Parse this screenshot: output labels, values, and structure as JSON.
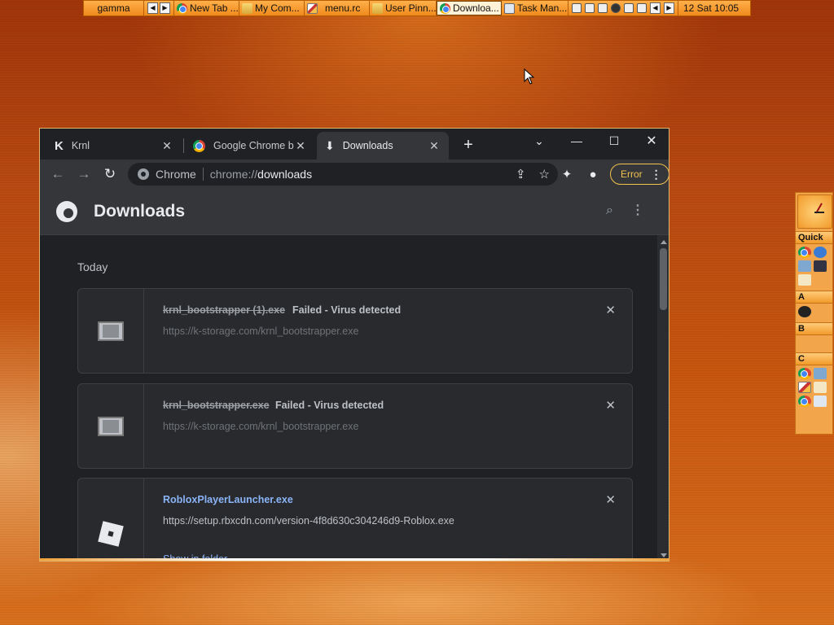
{
  "taskbar": {
    "workspace": "gamma",
    "tasks": [
      {
        "label": "New Tab ...",
        "icon": "chrome-icon"
      },
      {
        "label": "My Com...",
        "icon": "folder-icon"
      },
      {
        "label": "menu.rc",
        "icon": "editor-icon"
      },
      {
        "label": "User Pinn...",
        "icon": "folder-icon"
      },
      {
        "label": "Downloa...",
        "icon": "chrome-icon"
      },
      {
        "label": "Task Man...",
        "icon": "task-manager-icon"
      }
    ],
    "clock": "12 Sat 10:05"
  },
  "dock": {
    "sections": [
      "Quick",
      "A",
      "B",
      "C"
    ]
  },
  "browser": {
    "tabs": [
      {
        "title": "Krnl"
      },
      {
        "title": "Google Chrome bl"
      },
      {
        "title": "Downloads"
      }
    ],
    "new_tab": "+",
    "omnibox": {
      "site_label": "Chrome",
      "url_scheme": "chrome://",
      "url_host": "downloads"
    },
    "profile_button": "Error"
  },
  "downloads": {
    "title": "Downloads",
    "section": "Today",
    "items": [
      {
        "name": "krnl_bootstrapper (1).exe",
        "status": "Failed - Virus detected",
        "url": "https://k-storage.com/krnl_bootstrapper.exe"
      },
      {
        "name": "krnl_bootstrapper.exe",
        "status": "Failed - Virus detected",
        "url": "https://k-storage.com/krnl_bootstrapper.exe"
      },
      {
        "name": "RobloxPlayerLauncher.exe",
        "status": "",
        "url": "https://setup.rbxcdn.com/version-4f8d630c304246d9-Roblox.exe",
        "action": "Show in folder"
      }
    ]
  }
}
